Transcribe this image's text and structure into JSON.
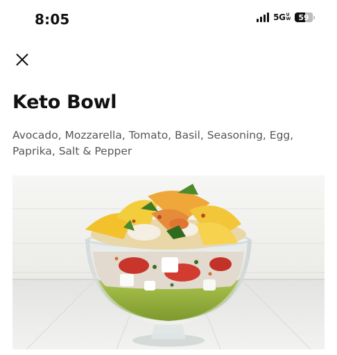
{
  "status_bar": {
    "time": "8:05",
    "network": "5G",
    "network_suffix_top": "U",
    "network_suffix_bottom": "W",
    "battery_level": "59",
    "battery_fraction": 0.59,
    "signal_bars": 4
  },
  "close_icon": "close-icon",
  "recipe": {
    "title": "Keto Bowl",
    "ingredients": "Avocado, Mozzarella, Tomato, Basil, Seasoning, Egg, Paprika, Salt & Pepper"
  },
  "colors": {
    "text": "#111111",
    "secondary_text": "#555555",
    "background": "#ffffff"
  }
}
